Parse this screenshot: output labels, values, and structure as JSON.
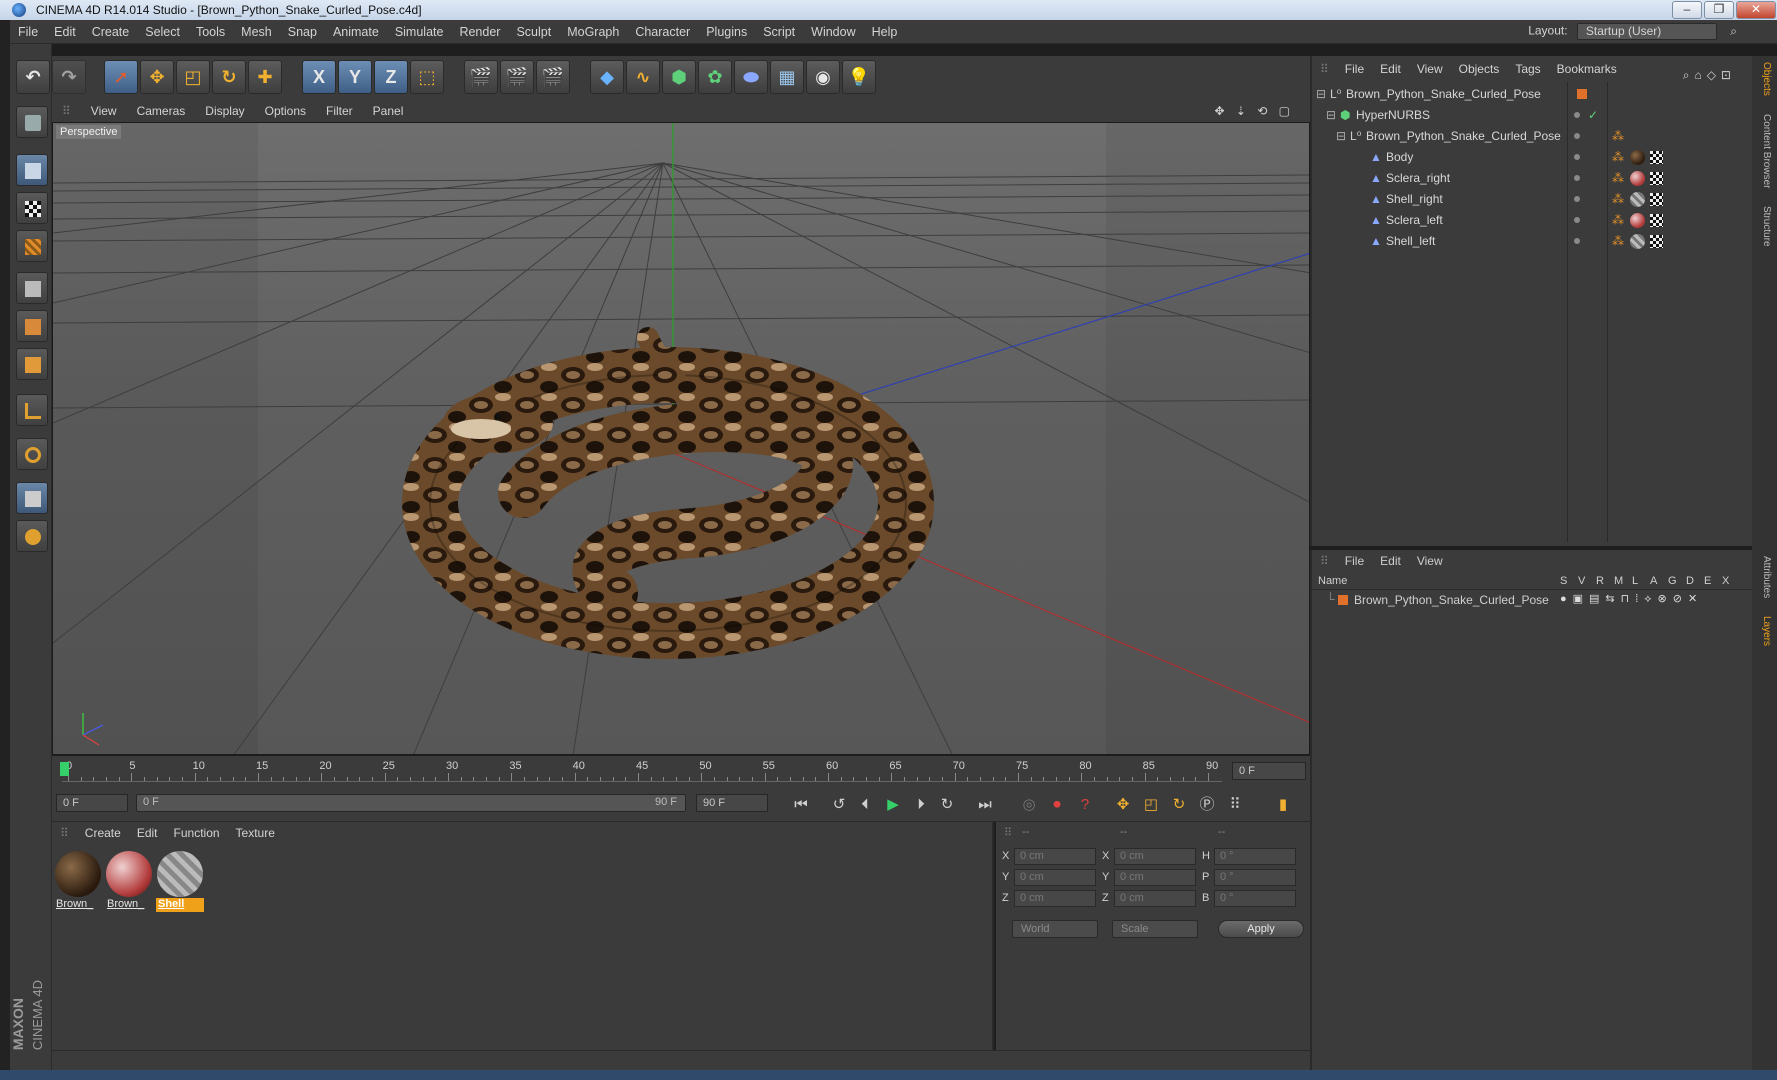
{
  "window": {
    "title": "CINEMA 4D R14.014 Studio - [Brown_Python_Snake_Curled_Pose.c4d]"
  },
  "menubar": {
    "items": [
      "File",
      "Edit",
      "Create",
      "Select",
      "Tools",
      "Mesh",
      "Snap",
      "Animate",
      "Simulate",
      "Render",
      "Sculpt",
      "MoGraph",
      "Character",
      "Plugins",
      "Script",
      "Window",
      "Help"
    ],
    "layout_label": "Layout:",
    "layout_value": "Startup (User)"
  },
  "toolbar": {
    "axis_x": "X",
    "axis_y": "Y",
    "axis_z": "Z"
  },
  "viewport": {
    "menu": [
      "View",
      "Cameras",
      "Display",
      "Options",
      "Filter",
      "Panel"
    ],
    "label": "Perspective"
  },
  "timeline": {
    "ticks": [
      "0",
      "5",
      "10",
      "15",
      "20",
      "25",
      "30",
      "35",
      "40",
      "45",
      "50",
      "55",
      "60",
      "65",
      "70",
      "75",
      "80",
      "85",
      "90"
    ],
    "frame_display": "0 F",
    "start_field": "0 F",
    "range_start": "0 F",
    "range_end": "90 F",
    "end_field": "90 F"
  },
  "materials": {
    "menu": [
      "Create",
      "Edit",
      "Function",
      "Texture"
    ],
    "items": [
      {
        "label": "Brown_",
        "color": "#4a3420"
      },
      {
        "label": "Brown_",
        "color": "#b23a3a"
      },
      {
        "label": "Shell",
        "color": "#9a9a9a",
        "selected": true
      }
    ]
  },
  "coordinates": {
    "headers": [
      "--",
      "--",
      "--"
    ],
    "rows": [
      {
        "l1": "X",
        "v1": "0 cm",
        "l2": "X",
        "v2": "0 cm",
        "l3": "H",
        "v3": "0 °"
      },
      {
        "l1": "Y",
        "v1": "0 cm",
        "l2": "Y",
        "v2": "0 cm",
        "l3": "P",
        "v3": "0 °"
      },
      {
        "l1": "Z",
        "v1": "0 cm",
        "l2": "Z",
        "v2": "0 cm",
        "l3": "B",
        "v3": "0 °"
      }
    ],
    "mode": "World",
    "scale": "Scale",
    "apply": "Apply"
  },
  "objects": {
    "menu": [
      "File",
      "Edit",
      "View",
      "Objects",
      "Tags",
      "Bookmarks"
    ],
    "tree": [
      {
        "name": "Brown_Python_Snake_Curled_Pose",
        "indent": 0
      },
      {
        "name": "HyperNURBS",
        "indent": 1
      },
      {
        "name": "Brown_Python_Snake_Curled_Pose",
        "indent": 2
      },
      {
        "name": "Body",
        "indent": 3
      },
      {
        "name": "Sclera_right",
        "indent": 3
      },
      {
        "name": "Shell_right",
        "indent": 3
      },
      {
        "name": "Sclera_left",
        "indent": 3
      },
      {
        "name": "Shell_left",
        "indent": 3
      }
    ]
  },
  "layers": {
    "menu": [
      "File",
      "Edit",
      "View"
    ],
    "columns": [
      "Name",
      "S",
      "V",
      "R",
      "M",
      "L",
      "A",
      "G",
      "D",
      "E",
      "X"
    ],
    "rows": [
      {
        "name": "Brown_Python_Snake_Curled_Pose",
        "color": "#e0702a"
      }
    ]
  },
  "right_tabs": [
    "Objects",
    "Content Browser",
    "Structure",
    "Attributes",
    "Layers"
  ],
  "branding": {
    "line1": "MAXON",
    "line2": "CINEMA 4D"
  }
}
